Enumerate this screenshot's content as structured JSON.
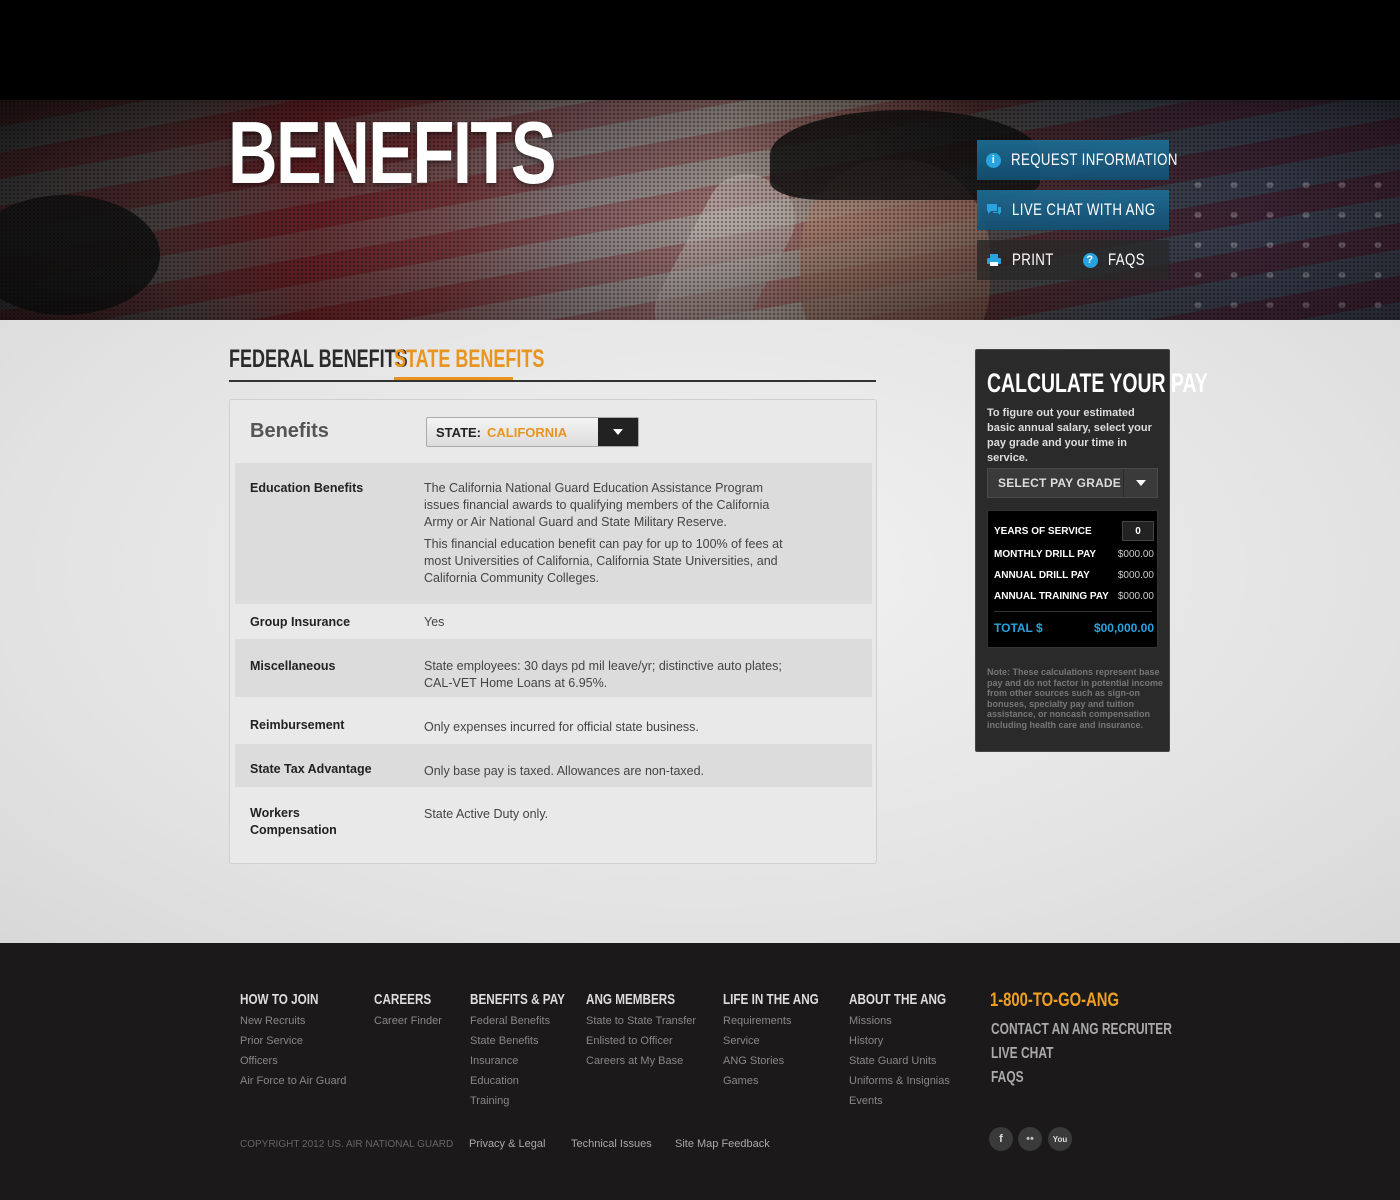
{
  "hero": {
    "title": "BENEFITS",
    "buttons": {
      "request_info": "REQUEST INFORMATION",
      "live_chat": "LIVE CHAT WITH ANG",
      "print": "PRINT",
      "faqs": "FAQS"
    }
  },
  "tabs": [
    {
      "label": "FEDERAL BENEFITS",
      "active": false
    },
    {
      "label": "STATE BENEFITS",
      "active": true
    }
  ],
  "benefits": {
    "title": "Benefits",
    "state_label": "STATE:",
    "state_value": "CALIFORNIA",
    "rows": [
      {
        "label": "Education Benefits",
        "value": "The California National Guard Education Assistance Program issues financial awards to qualifying members of the California Army or Air National Guard and State Military Reserve.",
        "value2": "This financial education benefit can pay for up to 100% of fees at most Universities of California, California State Universities, and California Community Colleges."
      },
      {
        "label": "Group Insurance",
        "value": "Yes"
      },
      {
        "label": "Miscellaneous",
        "value": "State employees: 30 days pd mil leave/yr; distinctive auto plates; CAL-VET Home Loans at 6.95%."
      },
      {
        "label": "Reimbursement",
        "value": "Only expenses incurred for official state business."
      },
      {
        "label": "State Tax Advantage",
        "value": "Only base pay is taxed. Allowances are non-taxed."
      },
      {
        "label": "Workers Compensation",
        "value": "State Active Duty only."
      }
    ]
  },
  "calculator": {
    "title": "CALCULATE YOUR PAY",
    "description": "To figure out your estimated basic annual salary, select your pay grade and your time in service.",
    "pay_grade_placeholder": "SELECT PAY GRADE",
    "years_label": "YEARS OF SERVICE",
    "years_value": "0",
    "monthly_label": "MONTHLY DRILL PAY",
    "monthly_value": "$000.00",
    "annual_drill_label": "ANNUAL DRILL PAY",
    "annual_drill_value": "$000.00",
    "annual_training_label": "ANNUAL TRAINING PAY",
    "annual_training_value": "$000.00",
    "total_label": "TOTAL $",
    "total_value": "$00,000.00",
    "note": "Note: These calculations represent base pay and do not factor in potential income from other sources such as sign-on bonuses, specialty pay and tuition assistance, or noncash compensation including health care and insurance."
  },
  "footer": {
    "columns": [
      {
        "heading": "HOW TO JOIN",
        "links": [
          "New Recruits",
          "Prior Service",
          "Officers",
          "Air Force to Air Guard"
        ]
      },
      {
        "heading": "CAREERS",
        "links": [
          "Career Finder"
        ]
      },
      {
        "heading": "BENEFITS & PAY",
        "links": [
          "Federal Benefits",
          "State Benefits",
          "Insurance",
          "Education",
          "Training"
        ]
      },
      {
        "heading": "ANG MEMBERS",
        "links": [
          "State to State Transfer",
          "Enlisted to Officer",
          "Careers at My Base"
        ]
      },
      {
        "heading": "LIFE IN THE ANG",
        "links": [
          "Requirements",
          "Service",
          "ANG Stories",
          "Games"
        ]
      },
      {
        "heading": "ABOUT THE ANG",
        "links": [
          "Missions",
          "History",
          "State Guard Units",
          "Uniforms & Insignias",
          "Events"
        ]
      }
    ],
    "phone": "1-800-TO-GO-ANG",
    "contact": "CONTACT AN ANG RECRUITER",
    "live_chat": "LIVE CHAT",
    "faqs": "FAQS",
    "copyright": "COPYRIGHT 2012 US. AIR NATIONAL GUARD",
    "legal_links": [
      "Privacy & Legal",
      "Technical Issues",
      "Site Map Feedback"
    ],
    "social": [
      {
        "icon": "facebook-icon",
        "glyph": "f"
      },
      {
        "icon": "flickr-icon",
        "glyph": "••"
      },
      {
        "icon": "youtube-icon",
        "glyph": "You"
      }
    ]
  },
  "colors": {
    "accent_orange": "#e8941e",
    "accent_blue": "#29a3e0",
    "footer_bg": "#1b1919"
  }
}
